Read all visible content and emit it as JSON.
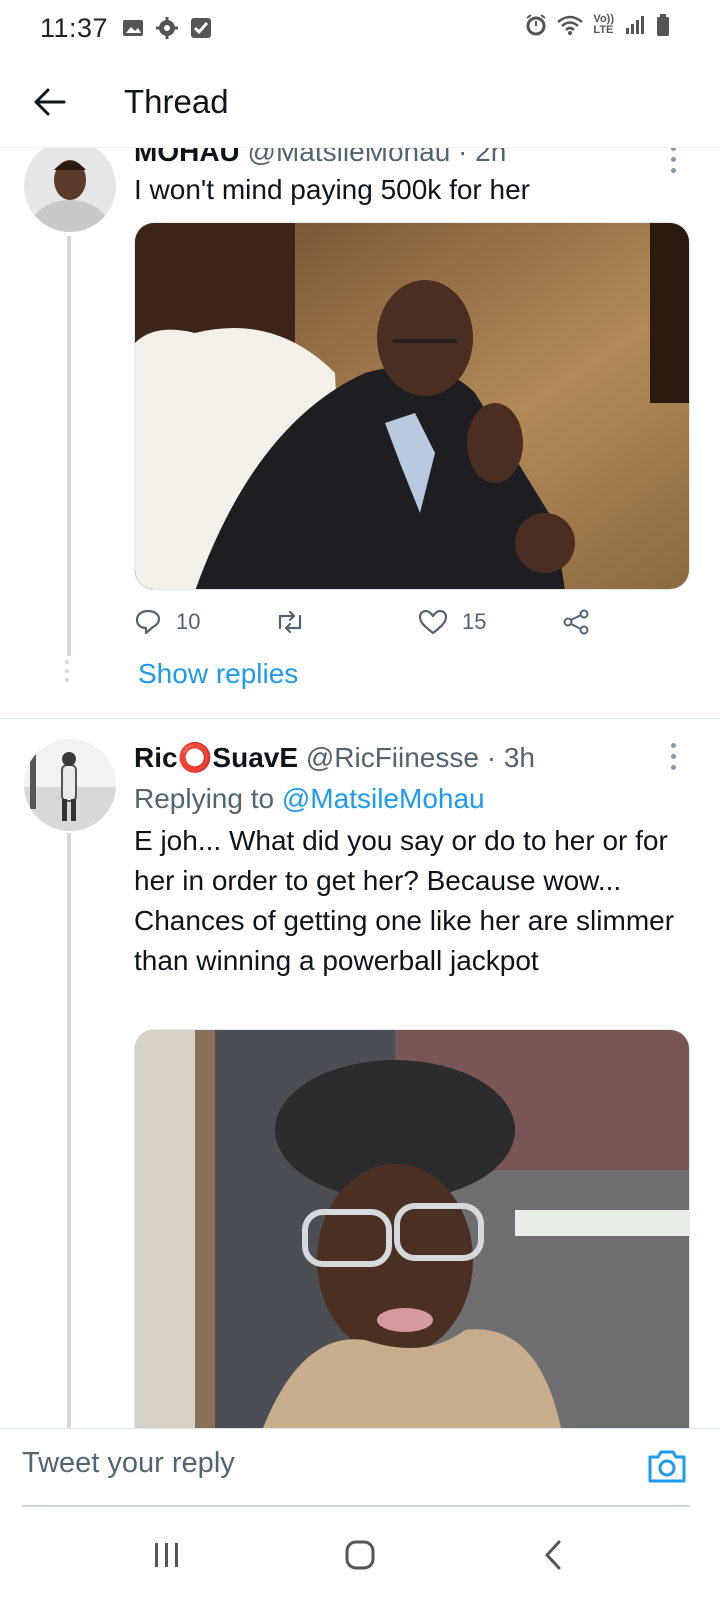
{
  "status_bar": {
    "time": "11:37",
    "left_icons": [
      "gallery-icon",
      "gear-icon",
      "checkbox-icon"
    ],
    "right_icons": [
      "alarm-icon",
      "wifi-icon",
      "volte-icon",
      "signal-icon",
      "battery-icon"
    ],
    "volte_label_top": "Vo))",
    "volte_label_bottom": "LTE"
  },
  "header": {
    "title": "Thread",
    "back_icon": "arrow-left-icon"
  },
  "tweets": [
    {
      "name": "MOHAU",
      "handle": "@MatsileMohau · 2h",
      "text": "I won't mind paying 500k for her",
      "media_desc": "photo",
      "reply_count": "10",
      "like_count": "15",
      "show_replies": "Show replies"
    },
    {
      "name": "Ric⭕SuavE",
      "handle": "@RicFiinesse · 3h",
      "replying_prefix": "Replying to ",
      "replying_to": "@MatsileMohau",
      "text": "E joh... What did you say or do to her or for her in order to get her? Because wow... Chances of getting one like her are slimmer than winning a powerball jackpot",
      "media_desc": "photo"
    }
  ],
  "composer": {
    "placeholder": "Tweet your reply",
    "camera_icon": "camera-icon"
  },
  "colors": {
    "accent": "#1d9bf0",
    "secondary_text": "#536471",
    "thread_line": "#cfd9de"
  }
}
